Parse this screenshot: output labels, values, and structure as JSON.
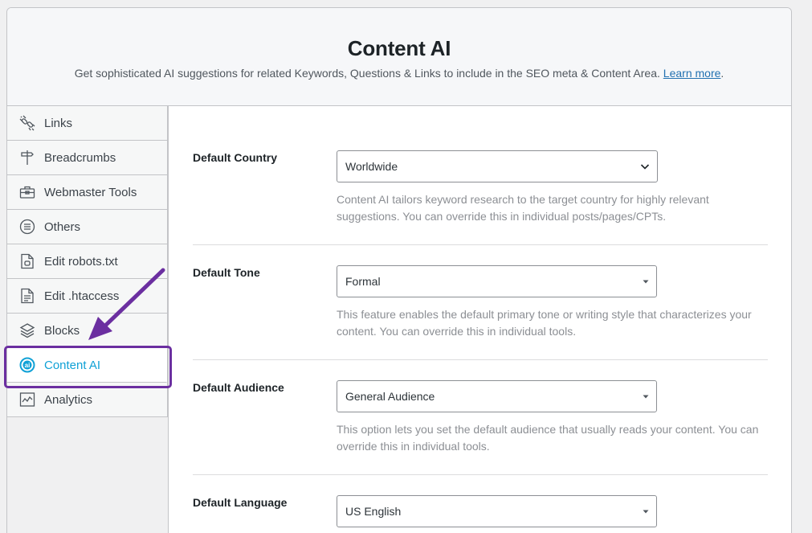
{
  "header": {
    "title": "Content AI",
    "subtitle": "Get sophisticated AI suggestions for related Keywords, Questions & Links to include in the SEO meta & Content Area.",
    "learn_more": "Learn more",
    "period": "."
  },
  "sidebar": {
    "items": [
      {
        "label": "Links",
        "icon": "links-icon"
      },
      {
        "label": "Breadcrumbs",
        "icon": "signpost-icon"
      },
      {
        "label": "Webmaster Tools",
        "icon": "toolbox-icon"
      },
      {
        "label": "Others",
        "icon": "list-circle-icon"
      },
      {
        "label": "Edit robots.txt",
        "icon": "file-robot-icon"
      },
      {
        "label": "Edit .htaccess",
        "icon": "file-text-icon"
      },
      {
        "label": "Blocks",
        "icon": "blocks-icon"
      },
      {
        "label": "Content AI",
        "icon": "content-ai-icon",
        "active": true
      },
      {
        "label": "Analytics",
        "icon": "analytics-chart-icon"
      }
    ]
  },
  "settings": {
    "country": {
      "label": "Default Country",
      "value": "Worldwide",
      "description": "Content AI tailors keyword research to the target country for highly relevant suggestions. You can override this in individual posts/pages/CPTs."
    },
    "tone": {
      "label": "Default Tone",
      "value": "Formal",
      "description": "This feature enables the default primary tone or writing style that characterizes your content. You can override this in individual tools."
    },
    "audience": {
      "label": "Default Audience",
      "value": "General Audience",
      "description": "This option lets you set the default audience that usually reads your content. You can override this in individual tools."
    },
    "language": {
      "label": "Default Language",
      "value": "US English"
    }
  },
  "colors": {
    "accent": "#10a1d6",
    "highlight": "#6b2fa0",
    "link": "#2271b1"
  }
}
